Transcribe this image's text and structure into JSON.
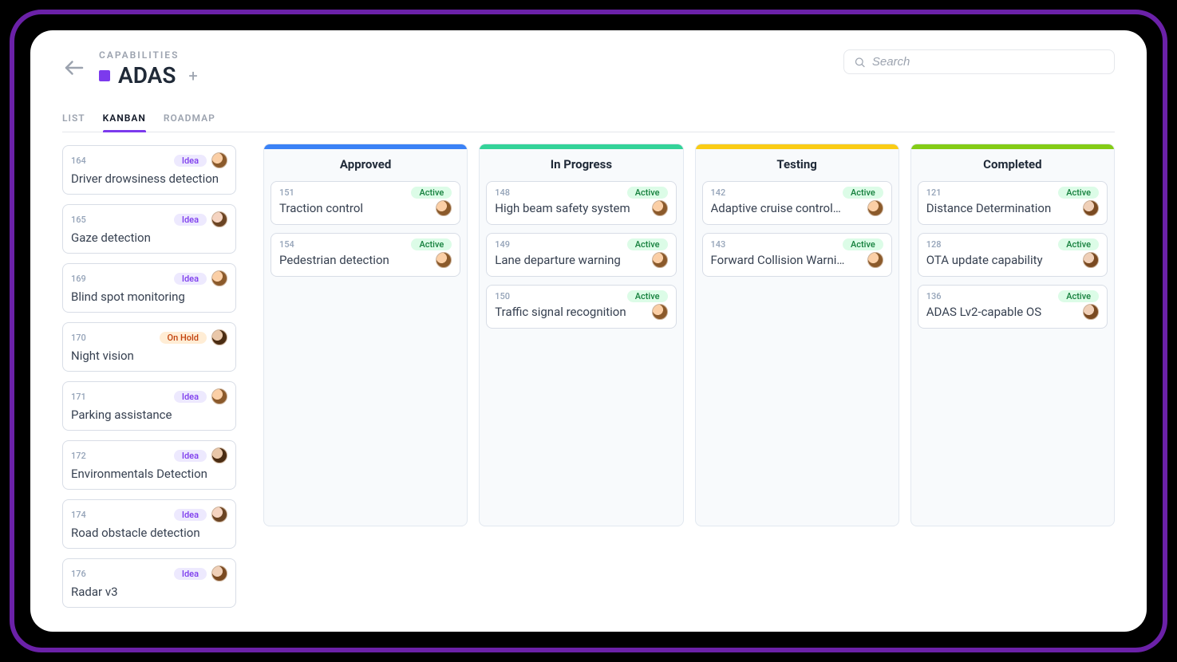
{
  "header": {
    "breadcrumb": "CAPABILITIES",
    "title": "ADAS"
  },
  "search": {
    "placeholder": "Search"
  },
  "tabs": [
    {
      "label": "LIST",
      "active": false
    },
    {
      "label": "KANBAN",
      "active": true
    },
    {
      "label": "ROADMAP",
      "active": false
    }
  ],
  "status_labels": {
    "idea": "Idea",
    "hold": "On Hold",
    "active": "Active"
  },
  "list_column": [
    {
      "id": "164",
      "title": "Driver drowsiness detection",
      "status": "idea",
      "avatar": "a"
    },
    {
      "id": "165",
      "title": "Gaze detection",
      "status": "idea",
      "avatar": "b"
    },
    {
      "id": "169",
      "title": "Blind spot monitoring",
      "status": "idea",
      "avatar": "a"
    },
    {
      "id": "170",
      "title": "Night vision",
      "status": "hold",
      "avatar": "c"
    },
    {
      "id": "171",
      "title": "Parking assistance",
      "status": "idea",
      "avatar": "a"
    },
    {
      "id": "172",
      "title": "Environmentals Detection",
      "status": "idea",
      "avatar": "c"
    },
    {
      "id": "174",
      "title": "Road obstacle detection",
      "status": "idea",
      "avatar": "b"
    },
    {
      "id": "176",
      "title": "Radar v3",
      "status": "idea",
      "avatar": "d"
    }
  ],
  "columns": [
    {
      "name": "Approved",
      "bar": "bar-approved",
      "cards": [
        {
          "id": "151",
          "title": "Traction control",
          "status": "active",
          "avatar": "a"
        },
        {
          "id": "154",
          "title": "Pedestrian detection",
          "status": "active",
          "avatar": "a"
        }
      ]
    },
    {
      "name": "In Progress",
      "bar": "bar-progress",
      "cards": [
        {
          "id": "148",
          "title": "High beam safety system",
          "status": "active",
          "avatar": "a"
        },
        {
          "id": "149",
          "title": "Lane departure warning",
          "status": "active",
          "avatar": "a"
        },
        {
          "id": "150",
          "title": "Traffic signal recognition",
          "status": "active",
          "avatar": "a"
        }
      ]
    },
    {
      "name": "Testing",
      "bar": "bar-testing",
      "cards": [
        {
          "id": "142",
          "title": "Adaptive cruise control…",
          "status": "active",
          "avatar": "a"
        },
        {
          "id": "143",
          "title": "Forward Collision Warni…",
          "status": "active",
          "avatar": "a"
        }
      ]
    },
    {
      "name": "Completed",
      "bar": "bar-completed",
      "cards": [
        {
          "id": "121",
          "title": "Distance Determination",
          "status": "active",
          "avatar": "d"
        },
        {
          "id": "128",
          "title": "OTA update capability",
          "status": "active",
          "avatar": "d"
        },
        {
          "id": "136",
          "title": "ADAS Lv2-capable OS",
          "status": "active",
          "avatar": "d"
        }
      ]
    }
  ]
}
